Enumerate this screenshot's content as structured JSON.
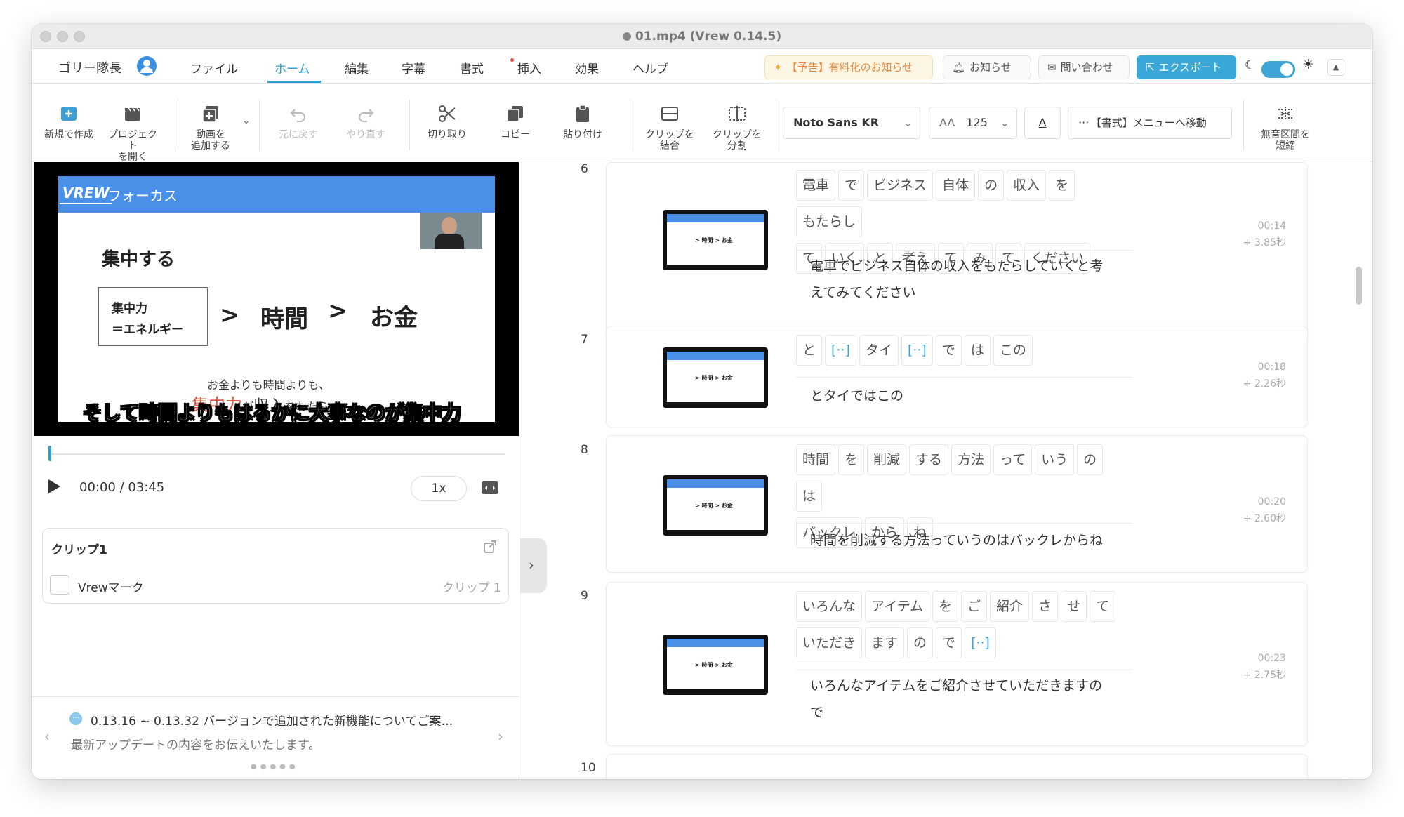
{
  "window": {
    "title": "01.mp4 (Vrew 0.14.5)"
  },
  "menubar": {
    "user": "ゴリー隊長",
    "items": [
      "ファイル",
      "ホーム",
      "編集",
      "字幕",
      "書式",
      "挿入",
      "効果",
      "ヘルプ"
    ],
    "active": "ホーム",
    "ad_label": "【予告】有料化のお知らせ",
    "notice_label": "お知らせ",
    "contact_label": "問い合わせ",
    "export_label": "エクスポート"
  },
  "toolbar": {
    "new": "新規で作成",
    "open_line1": "プロジェクト",
    "open_line2": "を開く",
    "add_video_line1": "動画を",
    "add_video_line2": "追加する",
    "undo": "元に戻す",
    "redo": "やり直す",
    "cut": "切り取り",
    "copy": "コピー",
    "paste": "貼り付け",
    "merge_line1": "クリップを",
    "merge_line2": "結合",
    "split_line1": "クリップを",
    "split_line2": "分割",
    "font_name": "Noto Sans KR",
    "font_size": "125",
    "font_color_glyph": "A",
    "format_menu": "【書式】メニューへ移動",
    "shorten_line1": "無音区間を",
    "shorten_line2": "短縮"
  },
  "preview": {
    "slide_header": "フォーカス",
    "slide_logo": "VREW",
    "slide_title": "集中する",
    "box_line1": "集中力",
    "box_line2": "＝エネルギー",
    "arrow1": ">",
    "word_time": "時間",
    "arrow2": ">",
    "word_money": "お金",
    "note_line1": "お金よりも時間よりも、",
    "note_red": "集中力",
    "note_mid": "が",
    "note_big": "収入",
    "note_end": "をもたらす",
    "caption": "そして時間よりもはるかに大事なのが集中力"
  },
  "player": {
    "time": "00:00 / 03:45",
    "speed": "1x",
    "progress": 0
  },
  "clip_panel": {
    "title": "クリップ1",
    "item_label": "Vrewマーク",
    "item_value": "クリップ 1"
  },
  "news": {
    "title": "0.13.16 ~ 0.13.32 バージョンで追加された新機能についてご案…",
    "body": "最新アップデートの内容をお伝えいたします。"
  },
  "clips": [
    {
      "num": "6",
      "row1": [
        "電車",
        "で",
        "ビジネス",
        "自体",
        "の",
        "収入",
        "を",
        "もたらし"
      ],
      "row2": [
        "て",
        "いく",
        "と",
        "考え",
        "て",
        "み",
        "て",
        "ください"
      ],
      "sub1": "電車でビジネス自体の収入をもたらしていくと考",
      "sub2": "えてみてください",
      "time": "00:14",
      "dur": "+ 3.85秒"
    },
    {
      "num": "7",
      "row1": [
        "と",
        "[··]",
        "タイ",
        "[··]",
        "で",
        "は",
        "この"
      ],
      "sub1": "とタイではこの",
      "time": "00:18",
      "dur": "+ 2.26秒"
    },
    {
      "num": "8",
      "row1": [
        "時間",
        "を",
        "削減",
        "する",
        "方法",
        "って",
        "いう",
        "の",
        "は"
      ],
      "row2": [
        "バックレ",
        "から",
        "ね"
      ],
      "sub1": "時間を削減する方法っていうのはバックレからね",
      "time": "00:20",
      "dur": "+ 2.60秒"
    },
    {
      "num": "9",
      "row1": [
        "いろんな",
        "アイテム",
        "を",
        "ご",
        "紹介",
        "さ",
        "せ",
        "て"
      ],
      "row2": [
        "いただき",
        "ます",
        "の",
        "で",
        "[··]"
      ],
      "sub1": "いろんなアイテムをご紹介させていただきますの",
      "sub2": "で",
      "time": "00:23",
      "dur": "+ 2.75秒"
    },
    {
      "num": "10"
    }
  ]
}
